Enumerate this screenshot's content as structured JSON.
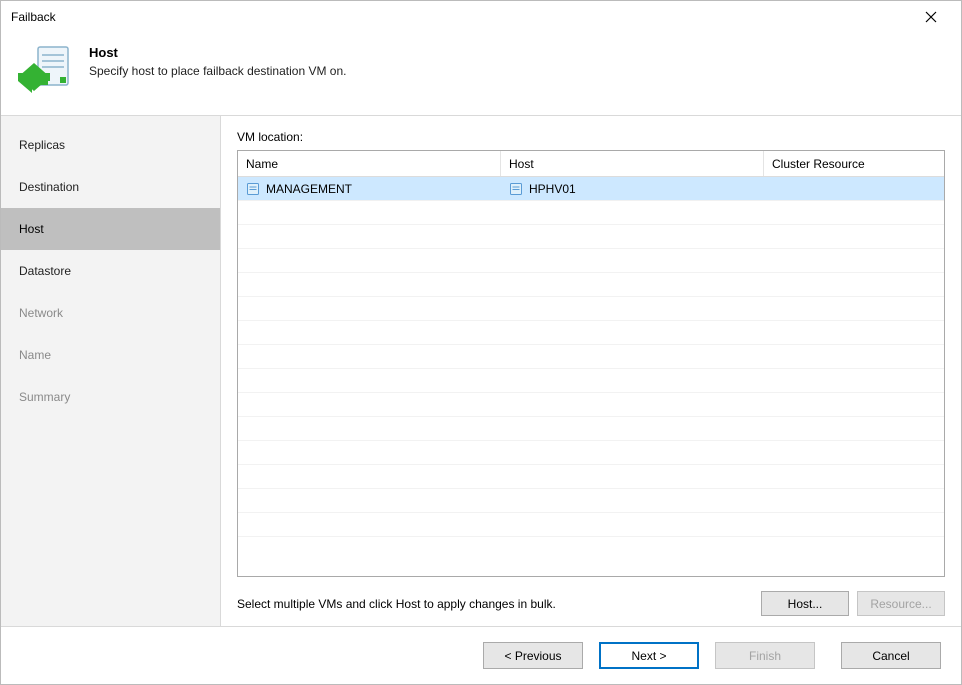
{
  "window": {
    "title": "Failback"
  },
  "header": {
    "title": "Host",
    "description": "Specify host to place failback destination VM on."
  },
  "sidebar": {
    "items": [
      {
        "label": "Replicas",
        "state": "normal"
      },
      {
        "label": "Destination",
        "state": "normal"
      },
      {
        "label": "Host",
        "state": "current"
      },
      {
        "label": "Datastore",
        "state": "normal"
      },
      {
        "label": "Network",
        "state": "disabled"
      },
      {
        "label": "Name",
        "state": "disabled"
      },
      {
        "label": "Summary",
        "state": "disabled"
      }
    ]
  },
  "content": {
    "section_label": "VM location:",
    "columns": {
      "name": "Name",
      "host": "Host",
      "cluster": "Cluster Resource"
    },
    "rows": [
      {
        "name": "MANAGEMENT",
        "host": "HPHV01",
        "cluster": "",
        "selected": true
      }
    ],
    "hint": "Select multiple VMs and click Host to apply changes in bulk.",
    "host_button": "Host...",
    "resource_button": "Resource..."
  },
  "footer": {
    "previous": "< Previous",
    "next": "Next >",
    "finish": "Finish",
    "cancel": "Cancel"
  }
}
